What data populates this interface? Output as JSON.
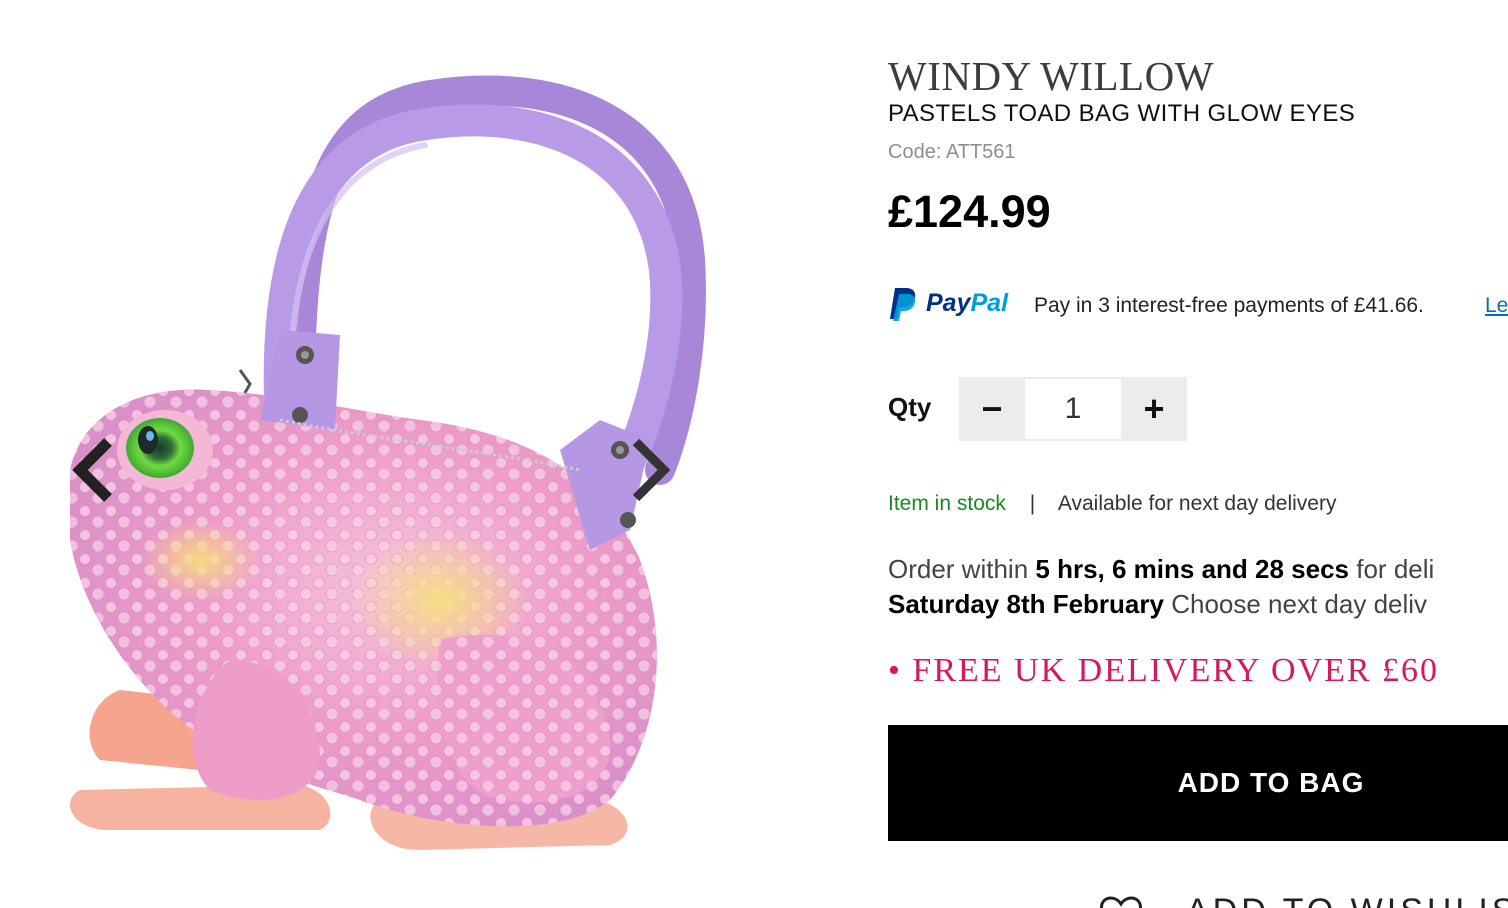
{
  "product": {
    "brand": "WINDY WILLOW",
    "title": "PASTELS TOAD BAG WITH GLOW EYES",
    "code": "Code: ATT561",
    "price": "£124.99"
  },
  "gallery": {
    "prev_icon": "chevron-left-icon",
    "next_icon": "chevron-right-icon"
  },
  "paypal": {
    "brand_pay": "Pay",
    "brand_pal": "Pal",
    "message": "Pay in 3 interest-free payments of £41.66.",
    "link": "Le"
  },
  "quantity": {
    "label": "Qty",
    "minus": "−",
    "value": "1",
    "plus": "+"
  },
  "stock": {
    "status": "Item in stock",
    "separator": "|",
    "availability": "Available for next day delivery"
  },
  "delivery_timer": {
    "prefix": "Order within",
    "countdown": "5 hrs, 6 mins and 28 secs",
    "suffix": "for deli",
    "date": "Saturday 8th February",
    "after_date": "Choose next day deliv"
  },
  "promo": {
    "free_delivery": "• FREE UK DELIVERY OVER £60"
  },
  "actions": {
    "add_to_bag": "ADD TO BAG",
    "wishlist": "ADD TO WISHLIST"
  },
  "colors": {
    "accent_pink": "#d6185e",
    "stock_green": "#198a1e",
    "paypal_blue": "#003087",
    "paypal_light": "#009cde"
  }
}
